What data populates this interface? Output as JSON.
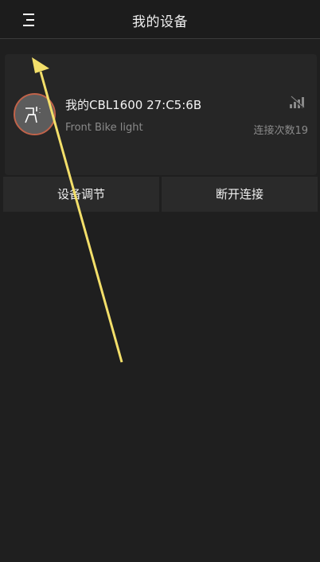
{
  "header": {
    "title": "我的设备"
  },
  "device": {
    "name": "我的CBL1600 27:C5:6B",
    "type": "Front Bike light",
    "connection_count": "连接次数19"
  },
  "actions": {
    "adjust_label": "设备调节",
    "disconnect_label": "断开连接"
  },
  "colors": {
    "background": "#1f1f1f",
    "card": "#262626",
    "avatar_border": "#c0634a",
    "annotation_arrow": "#f3df6a"
  },
  "icons": {
    "menu": "menu-icon",
    "avatar": "bike-light-icon",
    "signal": "no-signal-icon"
  }
}
